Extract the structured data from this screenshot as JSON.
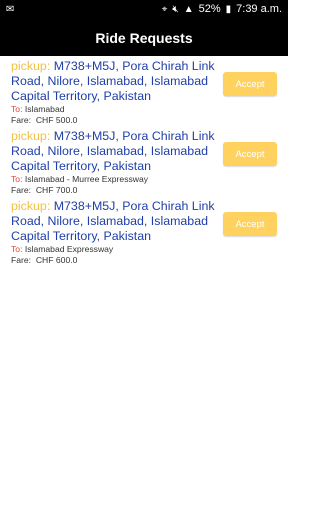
{
  "status_bar": {
    "battery": "52%",
    "time": "7:39 a.m."
  },
  "app_bar": {
    "title": "Ride Requests"
  },
  "requests": [
    {
      "pickup_label": "pickup:",
      "pickup_address": "M738+M5J, Pora Chirah Link Road, Nilore, Islamabad, Islamabad Capital Territory, Pakistan",
      "to_label": "To:",
      "destination": "Islamabad",
      "fare_label": "Fare:",
      "fare": "CHF 500.0",
      "accept_label": "Accept"
    },
    {
      "pickup_label": "pickup:",
      "pickup_address": "M738+M5J, Pora Chirah Link Road, Nilore, Islamabad, Islamabad Capital Territory, Pakistan",
      "to_label": "To:",
      "destination": "Islamabad - Murree Expressway",
      "fare_label": "Fare:",
      "fare": "CHF 700.0",
      "accept_label": "Accept"
    },
    {
      "pickup_label": "pickup:",
      "pickup_address": "M738+M5J, Pora Chirah Link Road, Nilore, Islamabad, Islamabad Capital Territory, Pakistan",
      "to_label": "To:",
      "destination": "Islamabad Expressway",
      "fare_label": "Fare:",
      "fare": "CHF 600.0",
      "accept_label": "Accept"
    }
  ]
}
